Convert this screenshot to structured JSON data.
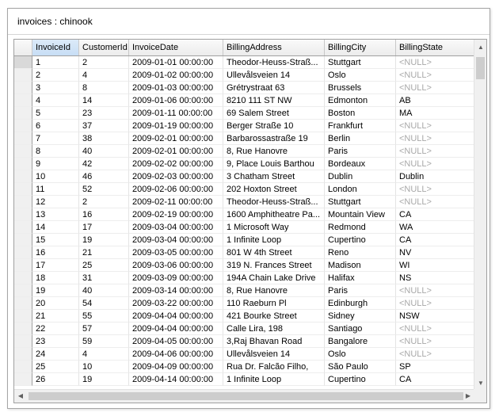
{
  "window": {
    "title": "invoices : chinook"
  },
  "columns": [
    "InvoiceId",
    "CustomerId",
    "InvoiceDate",
    "BillingAddress",
    "BillingCity",
    "BillingState"
  ],
  "rows": [
    [
      "1",
      "2",
      "2009-01-01 00:00:00",
      "Theodor-Heuss-Straß...",
      "Stuttgart",
      "<NULL>"
    ],
    [
      "2",
      "4",
      "2009-01-02 00:00:00",
      "Ullevålsveien 14",
      "Oslo",
      "<NULL>"
    ],
    [
      "3",
      "8",
      "2009-01-03 00:00:00",
      "Grétrystraat 63",
      "Brussels",
      "<NULL>"
    ],
    [
      "4",
      "14",
      "2009-01-06 00:00:00",
      "8210 111 ST NW",
      "Edmonton",
      "AB"
    ],
    [
      "5",
      "23",
      "2009-01-11 00:00:00",
      "69 Salem Street",
      "Boston",
      "MA"
    ],
    [
      "6",
      "37",
      "2009-01-19 00:00:00",
      "Berger Straße 10",
      "Frankfurt",
      "<NULL>"
    ],
    [
      "7",
      "38",
      "2009-02-01 00:00:00",
      "Barbarossastraße 19",
      "Berlin",
      "<NULL>"
    ],
    [
      "8",
      "40",
      "2009-02-01 00:00:00",
      "8, Rue Hanovre",
      "Paris",
      "<NULL>"
    ],
    [
      "9",
      "42",
      "2009-02-02 00:00:00",
      "9, Place Louis Barthou",
      "Bordeaux",
      "<NULL>"
    ],
    [
      "10",
      "46",
      "2009-02-03 00:00:00",
      "3 Chatham Street",
      "Dublin",
      "Dublin"
    ],
    [
      "11",
      "52",
      "2009-02-06 00:00:00",
      "202 Hoxton Street",
      "London",
      "<NULL>"
    ],
    [
      "12",
      "2",
      "2009-02-11 00:00:00",
      "Theodor-Heuss-Straß...",
      "Stuttgart",
      "<NULL>"
    ],
    [
      "13",
      "16",
      "2009-02-19 00:00:00",
      "1600 Amphitheatre Pa...",
      "Mountain View",
      "CA"
    ],
    [
      "14",
      "17",
      "2009-03-04 00:00:00",
      "1 Microsoft Way",
      "Redmond",
      "WA"
    ],
    [
      "15",
      "19",
      "2009-03-04 00:00:00",
      "1 Infinite Loop",
      "Cupertino",
      "CA"
    ],
    [
      "16",
      "21",
      "2009-03-05 00:00:00",
      "801 W 4th Street",
      "Reno",
      "NV"
    ],
    [
      "17",
      "25",
      "2009-03-06 00:00:00",
      "319 N. Frances Street",
      "Madison",
      "WI"
    ],
    [
      "18",
      "31",
      "2009-03-09 00:00:00",
      "194A Chain Lake Drive",
      "Halifax",
      "NS"
    ],
    [
      "19",
      "40",
      "2009-03-14 00:00:00",
      "8, Rue Hanovre",
      "Paris",
      "<NULL>"
    ],
    [
      "20",
      "54",
      "2009-03-22 00:00:00",
      "110 Raeburn Pl",
      "Edinburgh",
      "<NULL>"
    ],
    [
      "21",
      "55",
      "2009-04-04 00:00:00",
      "421 Bourke Street",
      "Sidney",
      "NSW"
    ],
    [
      "22",
      "57",
      "2009-04-04 00:00:00",
      "Calle Lira, 198",
      "Santiago",
      "<NULL>"
    ],
    [
      "23",
      "59",
      "2009-04-05 00:00:00",
      "3,Raj Bhavan Road",
      "Bangalore",
      "<NULL>"
    ],
    [
      "24",
      "4",
      "2009-04-06 00:00:00",
      "Ullevålsveien 14",
      "Oslo",
      "<NULL>"
    ],
    [
      "25",
      "10",
      "2009-04-09 00:00:00",
      "Rua Dr. Falcão Filho,",
      "São Paulo",
      "SP"
    ],
    [
      "26",
      "19",
      "2009-04-14 00:00:00",
      "1 Infinite Loop",
      "Cupertino",
      "CA"
    ]
  ],
  "icons": {
    "scroll_up": "▲",
    "scroll_down": "▼",
    "scroll_left": "◀",
    "scroll_right": "▶"
  },
  "colors": {
    "null_text": "#a8a8a8",
    "header_bg": "#f0f0f0",
    "active_header": "#c7def5"
  }
}
